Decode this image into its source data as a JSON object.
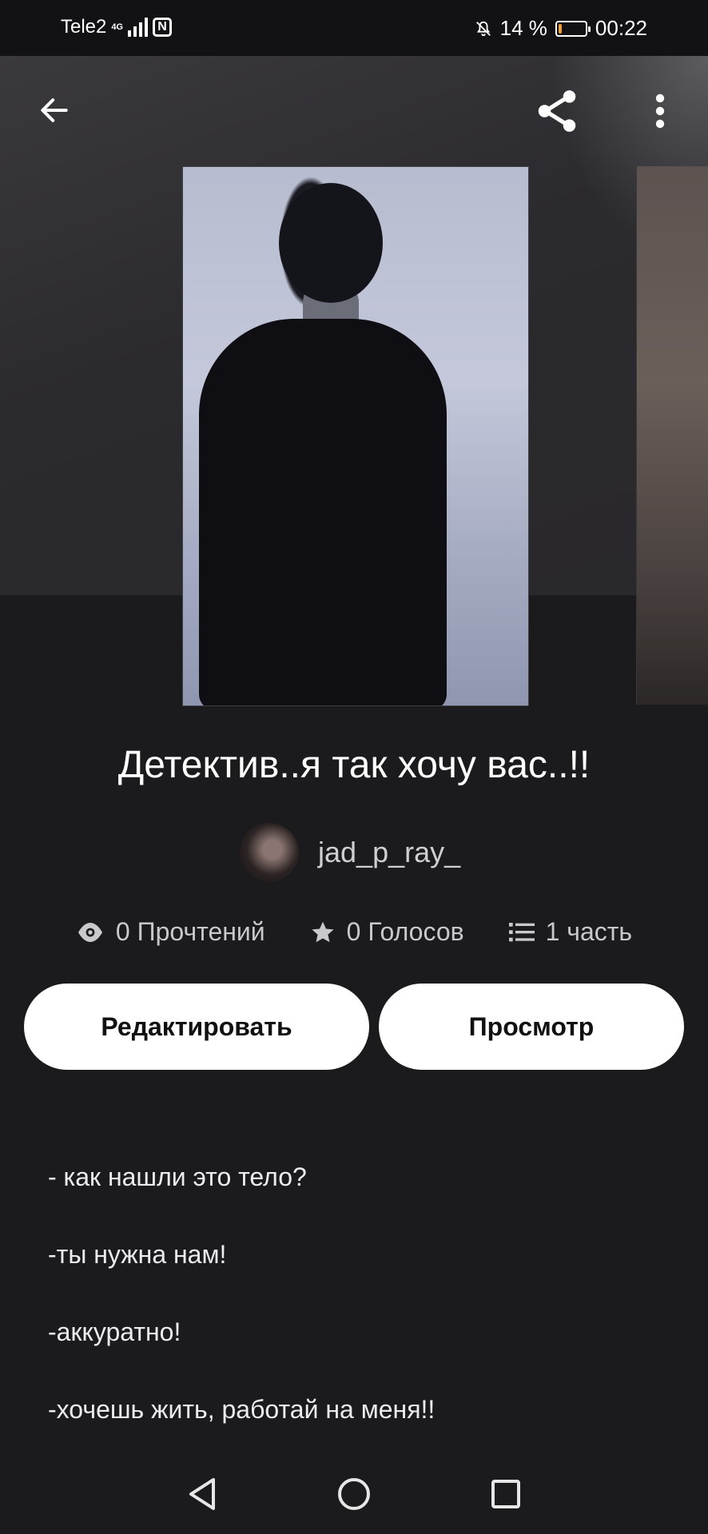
{
  "status_bar": {
    "carrier": "Tele2",
    "network": "4G",
    "battery_percent": "14 %",
    "battery_level": 0.14,
    "time": "00:22"
  },
  "story": {
    "title": "Детектив..я так хочу вас..!!",
    "author": "jad_p_ray_",
    "reads": "0 Прочтений",
    "votes": "0 Голосов",
    "parts": "1 часть"
  },
  "actions": {
    "edit_label": "Редактировать",
    "view_label": "Просмотр"
  },
  "description": [
    "- как нашли это тело?",
    "-ты нужна нам!",
    "-аккуратно!",
    "-хочешь жить, работай на меня!!"
  ],
  "icons": {
    "back": "arrow-left-icon",
    "share": "share-icon",
    "more": "more-vertical-icon",
    "reads": "eye-icon",
    "votes": "star-icon",
    "parts": "list-icon"
  },
  "colors": {
    "background": "#1b1a1d",
    "button": "#ffffff",
    "battery": "#f2a12b"
  }
}
